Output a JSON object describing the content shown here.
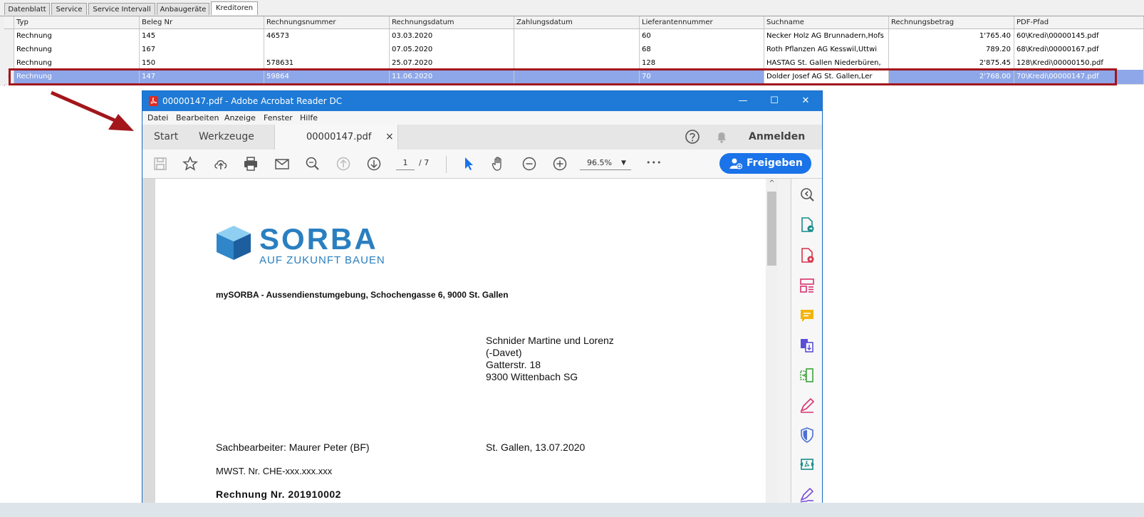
{
  "tabs": [
    "Datenblatt",
    "Service",
    "Service Intervall",
    "Anbaugeräte",
    "Kreditoren"
  ],
  "grid": {
    "columns": [
      "Typ",
      "Beleg Nr",
      "Rechnungsnummer",
      "Rechnungsdatum",
      "Zahlungsdatum",
      "Lieferantennummer",
      "Suchname",
      "Rechnungsbetrag",
      "PDF-Pfad"
    ],
    "rows": [
      {
        "typ": "Rechnung",
        "beleg": "145",
        "rnr": "46573",
        "rdatum": "03.03.2020",
        "zdatum": "",
        "lief": "60",
        "such": "Necker Holz AG Brunnadern,Hofs",
        "betrag": "1'765.40",
        "pfad": "60\\Kredi\\00000145.pdf"
      },
      {
        "typ": "Rechnung",
        "beleg": "167",
        "rnr": "",
        "rdatum": "07.05.2020",
        "zdatum": "",
        "lief": "68",
        "such": "Roth Pflanzen AG Kesswil,Uttwi",
        "betrag": "789.20",
        "pfad": "68\\Kredi\\00000167.pdf"
      },
      {
        "typ": "Rechnung",
        "beleg": "150",
        "rnr": "578631",
        "rdatum": "25.07.2020",
        "zdatum": "",
        "lief": "128",
        "such": "HASTAG St. Gallen Niederbüren,",
        "betrag": "2'875.45",
        "pfad": "128\\Kredi\\00000150.pdf"
      },
      {
        "typ": "Rechnung",
        "beleg": "147",
        "rnr": "59864",
        "rdatum": "11.06.2020",
        "zdatum": "",
        "lief": "70",
        "such": "Dolder Josef AG St. Gallen,Ler",
        "betrag": "2'768.00",
        "pfad": "70\\Kredi\\00000147.pdf"
      }
    ],
    "selected_row_marker": "›"
  },
  "acrobat": {
    "window_title": "00000147.pdf - Adobe Acrobat Reader DC",
    "controls": {
      "minimize": "—",
      "maximize": "☐",
      "close": "✕"
    },
    "menu": [
      "Datei",
      "Bearbeiten",
      "Anzeige",
      "Fenster",
      "Hilfe"
    ],
    "tabs": {
      "start": "Start",
      "tools": "Werkzeuge",
      "doc": "00000147.pdf",
      "close": "×"
    },
    "signin": "Anmelden",
    "page_current": "1",
    "page_total": "/ 7",
    "zoom": "96.5%",
    "zoom_caret": "▼",
    "more": "•••",
    "share": "Freigeben",
    "scroll_up": "^",
    "document": {
      "logo_name": "SORBA",
      "logo_tagline": "AUF ZUKUNFT BAUEN",
      "sender": "mySORBA - Aussendienstumgebung, Schochengasse 6, 9000  St. Gallen",
      "recipient": [
        "Schnider Martine und Lorenz",
        "(-Davet)",
        "Gatterstr. 18",
        "9300 Wittenbach SG"
      ],
      "clerk": "Sachbearbeiter:  Maurer Peter (BF)",
      "place_date": "St. Gallen, 13.07.2020",
      "vat": "MWST. Nr. CHE-xxx.xxx.xxx",
      "invoice_no": "Rechnung  Nr.  201910002"
    }
  },
  "colors": {
    "accent": "#1e7ad6",
    "selection": "#8ea7e8",
    "highlight": "#a3161c",
    "share_button": "#1a73e8"
  }
}
